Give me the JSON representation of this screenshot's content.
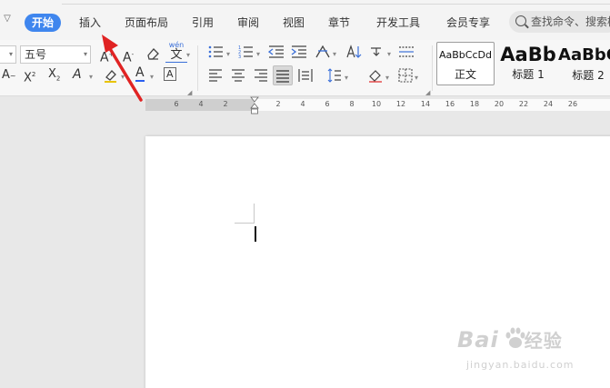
{
  "menu": {
    "toggle_icon": "chevron-down-icon",
    "tabs": [
      {
        "label": "开始",
        "active": true
      },
      {
        "label": "插入"
      },
      {
        "label": "页面布局"
      },
      {
        "label": "引用"
      },
      {
        "label": "审阅"
      },
      {
        "label": "视图"
      },
      {
        "label": "章节"
      },
      {
        "label": "开发工具"
      },
      {
        "label": "会员专享"
      }
    ],
    "search_text": "查找命令、搜索模"
  },
  "toolbar": {
    "font_size_value": "五号",
    "pinyin_label": "wén",
    "pinyin_char": "文",
    "superscript_label": "X",
    "subscript_label": "X",
    "font_color_label": "A",
    "char_border_label": "A",
    "styles": [
      {
        "preview": "AaBbCcDd",
        "label": "正文"
      },
      {
        "preview": "AaBb",
        "label": "标题 1"
      },
      {
        "preview": "AaBbC",
        "label": "标题 2"
      }
    ]
  },
  "ruler": {
    "ticks": [
      "6",
      "4",
      "2",
      "2",
      "4",
      "6",
      "8",
      "10",
      "12",
      "14",
      "16",
      "18",
      "20",
      "22",
      "24",
      "26"
    ]
  },
  "watermark": {
    "brand": "Bai",
    "brand_tail": "经验",
    "url": "jingyan.baidu.com"
  },
  "colors": {
    "active_tab": "#3f86ee",
    "font_color_underline": "#2a5ff0",
    "highlight_underline": "#e9c400",
    "annotation_arrow": "#e02323"
  }
}
